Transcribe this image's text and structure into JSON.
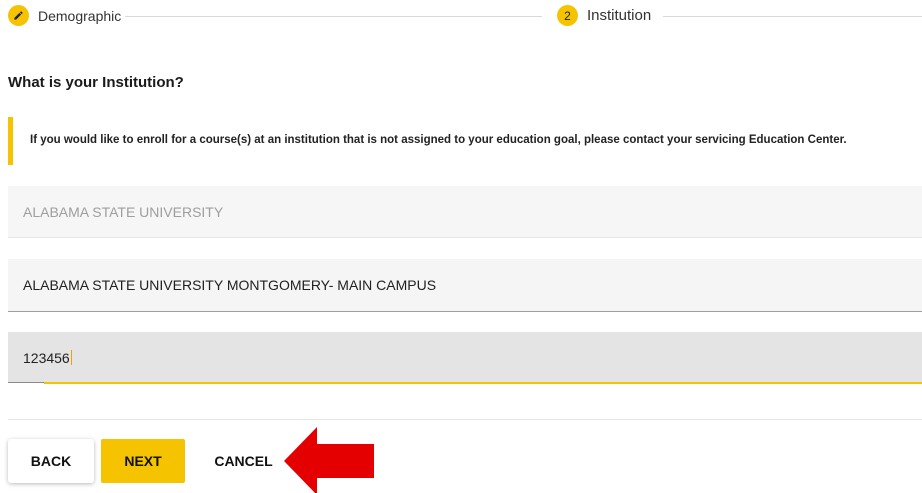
{
  "stepper": {
    "step1": {
      "label": "Demographic",
      "icon": "pencil-icon"
    },
    "step2": {
      "number": "2",
      "label": "Institution"
    }
  },
  "question": "What is your Institution?",
  "notice": "If you would like to enroll for a course(s) at an institution that is not assigned to your education goal, please contact your servicing Education Center.",
  "fields": {
    "institution": "ALABAMA STATE UNIVERSITY",
    "campus": "ALABAMA STATE UNIVERSITY MONTGOMERY- MAIN CAMPUS",
    "code": "123456"
  },
  "buttons": {
    "back": "BACK",
    "next": "NEXT",
    "cancel": "CANCEL"
  },
  "colors": {
    "accent": "#f5c300",
    "arrow": "#e40000"
  }
}
